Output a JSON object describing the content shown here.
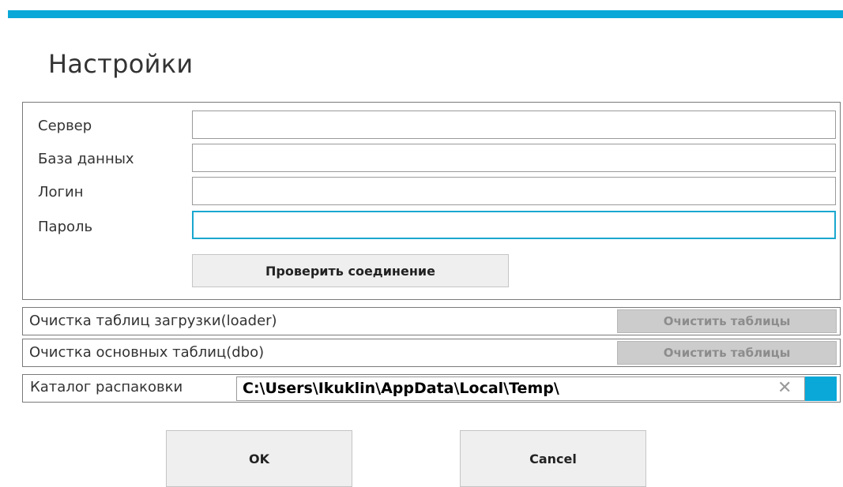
{
  "window": {
    "title": "Настройки",
    "accent_color": "#0aa8d8"
  },
  "connection": {
    "fields": [
      {
        "label": "Сервер",
        "value": ""
      },
      {
        "label": "База данных",
        "value": ""
      },
      {
        "label": "Логин",
        "value": ""
      },
      {
        "label": "Пароль",
        "value": ""
      }
    ],
    "check_button_label": "Проверить соединение"
  },
  "cleanup": [
    {
      "label": "Очистка таблиц загрузки(loader)",
      "button_label": "Очистить таблицы"
    },
    {
      "label": "Очистка основных таблиц(dbo)",
      "button_label": "Очистить таблицы"
    }
  ],
  "unpack": {
    "label": "Каталог распаковки",
    "value": "C:\\Users\\Ikuklin\\AppData\\Local\\Temp\\",
    "clear_icon": "close-icon",
    "clear_glyph": "✕",
    "browse_icon": "browse-icon"
  },
  "footer": {
    "ok_label": "OK",
    "cancel_label": "Cancel"
  }
}
